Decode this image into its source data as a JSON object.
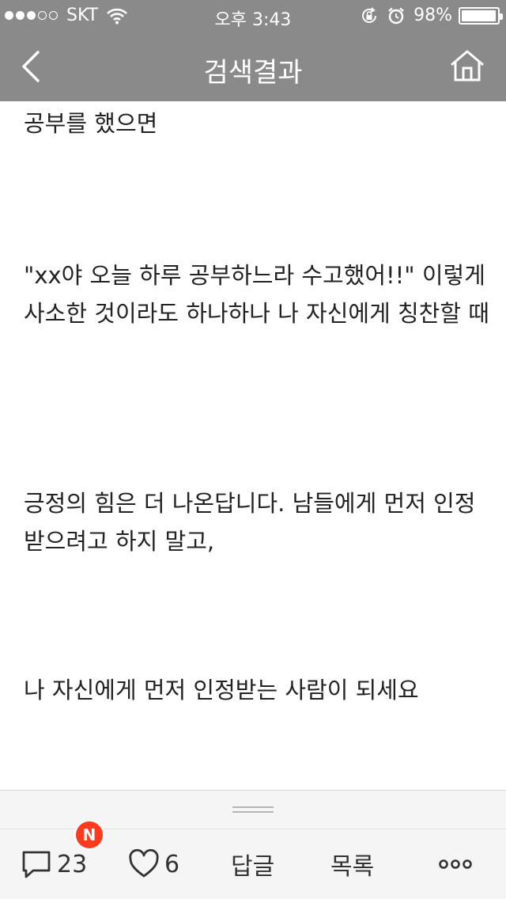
{
  "status_bar": {
    "carrier": "SKT",
    "time": "오후 3:43",
    "battery_percent": "98%",
    "battery_level": 0.98,
    "signal_filled": 3,
    "signal_total": 5
  },
  "nav": {
    "title": "검색결과"
  },
  "article": {
    "paragraphs": [
      "공부를 했으면",
      "\"xx야 오늘 하루 공부하느라 수고했어!!\" 이렇게 사소한 것이라도 하나하나 나 자신에게 칭찬할 때",
      "긍정의 힘은 더 나온답니다. 남들에게 먼저 인정받으려고 하지 말고,",
      "나 자신에게 먼저 인정받는 사람이 되세요"
    ]
  },
  "toolbar": {
    "comment_count": "23",
    "like_count": "6",
    "reply_label": "답글",
    "list_label": "목록",
    "new_badge": "N"
  },
  "colors": {
    "header_bg": "#8a8a8a",
    "badge": "#ff3a1f"
  }
}
